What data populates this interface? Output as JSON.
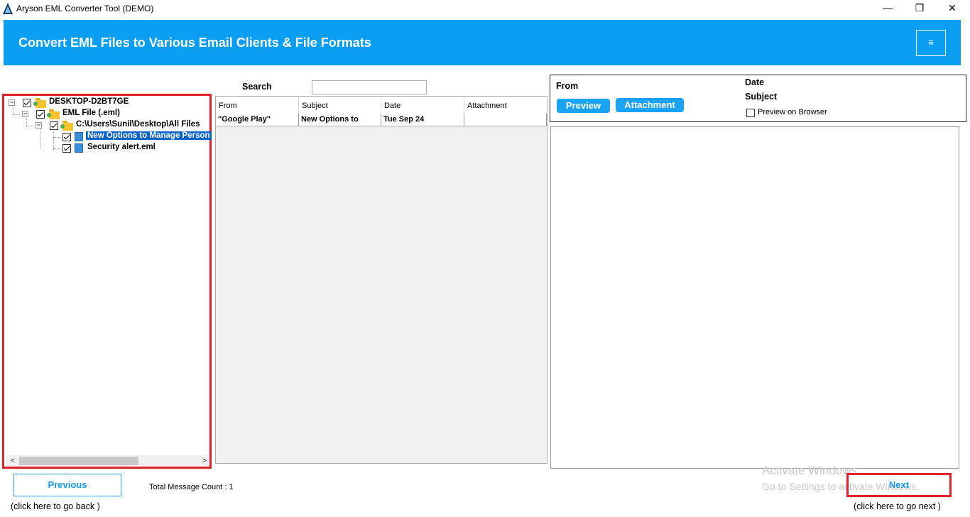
{
  "window": {
    "title": "Aryson EML Converter Tool (DEMO)",
    "minimize": "—",
    "restore": "❐",
    "close": "✕"
  },
  "banner": {
    "title": "Convert EML Files to Various Email Clients & File Formats",
    "menu_icon": "≡"
  },
  "tree": {
    "nodes": [
      {
        "label": "DESKTOP-D2BT7GE",
        "icon": "folder-icon",
        "checked": true
      },
      {
        "label": "EML File (.eml)",
        "icon": "folder-icon",
        "checked": true
      },
      {
        "label": "C:\\Users\\Sunil\\Desktop\\All Files",
        "icon": "folder-icon",
        "checked": true
      },
      {
        "label": "New Options to Manage Person",
        "icon": "file-icon",
        "checked": true,
        "selected": true
      },
      {
        "label": "Security alert.eml",
        "icon": "file-icon",
        "checked": true
      }
    ],
    "scroll_left": "<",
    "scroll_right": ">"
  },
  "search": {
    "label": "Search",
    "value": ""
  },
  "list": {
    "headers": [
      "From",
      "Subject",
      "Date",
      "Attachment"
    ],
    "rows": [
      [
        "\"Google Play\"",
        "New Options to",
        "Tue Sep 24",
        ""
      ]
    ]
  },
  "preview": {
    "from_label": "From",
    "date_label": "Date",
    "subject_label": "Subject",
    "preview_button": "Preview",
    "attachment_button": "Attachment",
    "preview_on_browser": "Preview on Browser"
  },
  "footer": {
    "previous": "Previous",
    "back_hint": "(click here to  go back )",
    "total_count": "Total Message Count : 1",
    "next": "Next",
    "next_hint": "(click here to  go next )",
    "watermark_line1": "Activate Windows",
    "watermark_line2": "Go to Settings to activate Windows."
  },
  "colors": {
    "banner": "#0a9ef2",
    "highlight_border": "#e0222e",
    "accent": "#1aa3f5"
  }
}
